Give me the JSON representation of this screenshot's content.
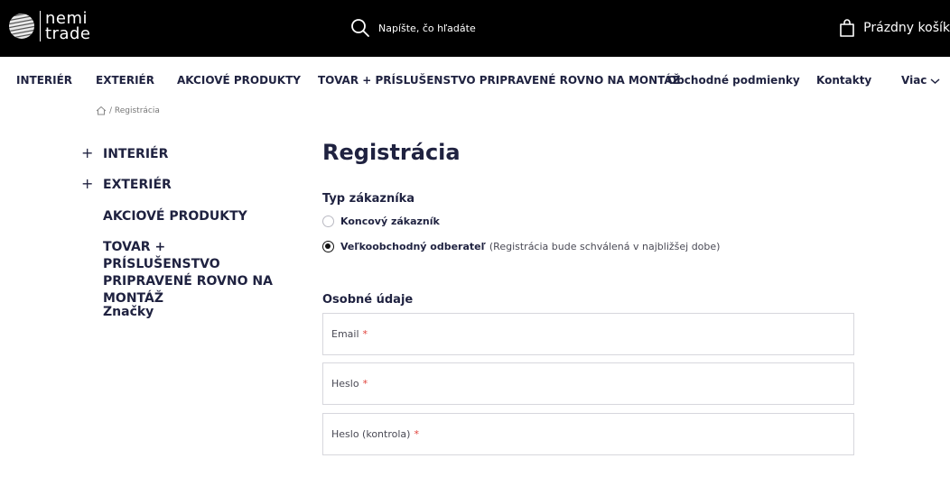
{
  "header": {
    "logo_line1": "nemi",
    "logo_line2": "trade",
    "search_placeholder": "Napíšte, čo hľadáte",
    "cart_label": "Prázdny košík"
  },
  "nav": {
    "items": [
      "INTERIÉR",
      "EXTERIÉR",
      "AKCIOVÉ PRODUKTY",
      "TOVAR + PRÍSLUŠENSTVO PRIPRAVENÉ ROVNO NA MONTÁŽ",
      "Obchodné podmienky",
      "Kontakty"
    ],
    "more_label": "Viac"
  },
  "breadcrumb": {
    "current": "/ Registrácia"
  },
  "sidebar": {
    "items": [
      {
        "label": "INTERIÉR"
      },
      {
        "label": "EXTERIÉR"
      },
      {
        "label": "AKCIOVÉ PRODUKTY"
      },
      {
        "label": "TOVAR + PRÍSLUŠENSTVO PRIPRAVENÉ ROVNO NA MONTÁŽ"
      },
      {
        "label": "Značky"
      }
    ],
    "expand_symbol": "+"
  },
  "main": {
    "title": "Registrácia",
    "customer_type_title": "Typ zákazníka",
    "customer_types": [
      {
        "label": "Koncový zákazník",
        "note": "",
        "selected": false
      },
      {
        "label": "Veľkoobchodný odberateľ",
        "note": "(Registrácia bude schválená v najbližšej dobe)",
        "selected": true
      }
    ],
    "personal_title": "Osobné údaje",
    "fields": [
      {
        "label": "Email",
        "required_mark": "*"
      },
      {
        "label": "Heslo",
        "required_mark": "*"
      },
      {
        "label": "Heslo (kontrola)",
        "required_mark": "*"
      }
    ]
  },
  "colors": {
    "topbar": "#000000",
    "text_dark": "#1f2240",
    "required": "#e0413a",
    "field_border": "#d7d7dd"
  },
  "icons": [
    "logo-mark-icon",
    "search-icon",
    "shopping-bag-icon",
    "chevron-down-icon",
    "home-icon"
  ]
}
